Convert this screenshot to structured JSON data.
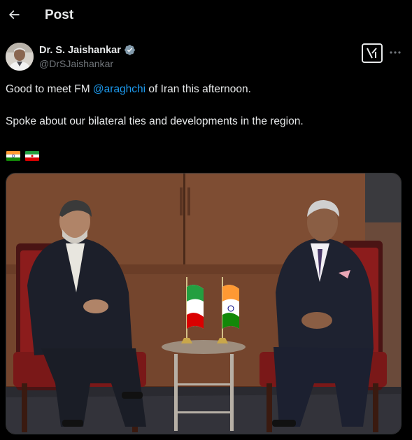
{
  "header": {
    "title": "Post"
  },
  "author": {
    "name": "Dr. S. Jaishankar",
    "handle": "@DrSJaishankar"
  },
  "tweet": {
    "line1_before": "Good to meet FM ",
    "mention": "@araghchi",
    "line1_after": " of Iran this afternoon.",
    "line2": "Spoke about our bilateral ties and developments in the region."
  },
  "flags": [
    "india-flag",
    "iran-flag"
  ],
  "icons": {
    "back": "arrow-left-icon",
    "verified": "verified-badge-icon",
    "grok": "grok-icon",
    "more": "more-icon"
  },
  "colors": {
    "background": "#000000",
    "text": "#e7e9ea",
    "muted": "#71767b",
    "link": "#1d9bf0"
  }
}
